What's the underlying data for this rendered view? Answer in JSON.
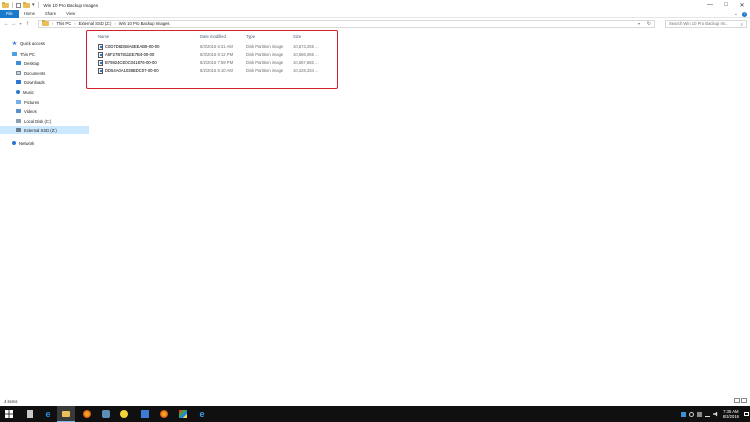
{
  "window": {
    "title": "Win 10 Pro Backup Images",
    "controls": [
      "—",
      "□",
      "✕"
    ]
  },
  "ribbon": {
    "tabs": [
      "File",
      "Home",
      "Share",
      "View"
    ],
    "expand_icon": "chevron-down-icon",
    "help_icon": "help-icon"
  },
  "address": {
    "breadcrumb": [
      "This PC",
      "External SSD (Z:)",
      "Win 10 Pro Backup Images"
    ]
  },
  "search": {
    "placeholder": "Search Win 10 Pro Backup Im..."
  },
  "nav_pane": {
    "items": [
      {
        "label": "Quick access",
        "icon": "star-icon"
      },
      {
        "label": "This PC",
        "icon": "computer-icon"
      },
      {
        "label": "Desktop",
        "icon": "desktop-icon"
      },
      {
        "label": "Documents",
        "icon": "documents-icon"
      },
      {
        "label": "Downloads",
        "icon": "downloads-icon"
      },
      {
        "label": "Music",
        "icon": "music-icon"
      },
      {
        "label": "Pictures",
        "icon": "pictures-icon"
      },
      {
        "label": "Videos",
        "icon": "videos-icon"
      },
      {
        "label": "Local Disk (C:)",
        "icon": "disk-icon"
      },
      {
        "label": "External SSD (Z:)",
        "icon": "ssd-icon",
        "selected": true
      },
      {
        "label": "Network",
        "icon": "network-icon"
      }
    ]
  },
  "file_list": {
    "columns": [
      "Name",
      "Date modified",
      "Type",
      "Size"
    ],
    "rows": [
      {
        "name": "C0D7D6D58A6EEAB9-00-00",
        "date": "8/3/2016 6:31 AM",
        "type": "Disk Partition image",
        "size": "10,573,255 ..."
      },
      {
        "name": "A6F27B7811EE7B4-00-00",
        "date": "8/3/2016 9:12 PM",
        "type": "Disk Partition image",
        "size": "10,566,066 ..."
      },
      {
        "name": "B79824CE0C041876-00-00",
        "date": "8/2/2016 7:59 PM",
        "type": "Disk Partition image",
        "size": "10,567,682 ..."
      },
      {
        "name": "DD54A0A1038BDC07-00-00",
        "date": "8/2/2016 6:10 AM",
        "type": "Disk Partition image",
        "size": "10,228,334 ..."
      }
    ]
  },
  "highlight_color": "#d4212a",
  "status_bar": {
    "item_count": "4 items"
  },
  "taskbar": {
    "clock_time": "7:35 AM",
    "clock_date": "8/3/2016",
    "apps": [
      "windows-start-icon",
      "calculator-icon",
      "edge-icon",
      "file-explorer-icon",
      "firefox-icon",
      "settings-icon",
      "smiley-icon",
      "photos-icon",
      "firefox-icon",
      "color-picker-icon",
      "ie-icon"
    ]
  }
}
